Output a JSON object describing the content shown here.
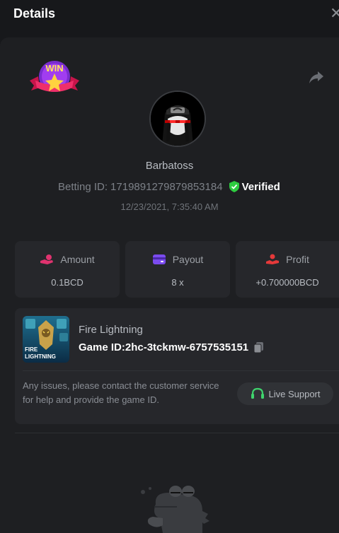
{
  "header": {
    "title": "Details",
    "close_icon": "close-icon"
  },
  "bet": {
    "badge_text": "WIN",
    "username": "Barbatoss",
    "betting_id_label": "Betting ID:",
    "betting_id": "1719891279879853184",
    "verified_label": "Verified",
    "datetime": "12/23/2021, 7:35:40 AM"
  },
  "stats": {
    "amount": {
      "label": "Amount",
      "value": "0.1BCD",
      "icon": "coin-hand-icon"
    },
    "payout": {
      "label": "Payout",
      "value": "8 x",
      "icon": "wallet-card-icon"
    },
    "profit": {
      "label": "Profit",
      "value": "+0.700000BCD",
      "icon": "profit-hand-icon"
    }
  },
  "game": {
    "thumb_text": "FIRE LIGHTNING",
    "name": "Fire Lightning",
    "id_label": "Game ID:",
    "id": "2hc-3tckmw-6757535151",
    "help_text": "Any issues, please contact the customer service for help and provide the game ID.",
    "live_support_label": "Live Support"
  },
  "colors": {
    "background": "#17181b",
    "panel": "#1e1f22",
    "card": "#26272b",
    "verified_green": "#2ecc40",
    "amount_icon": "#e0336f",
    "payout_icon": "#7b4bef",
    "profit_icon": "#e5393a",
    "support_green": "#3fd36d"
  }
}
